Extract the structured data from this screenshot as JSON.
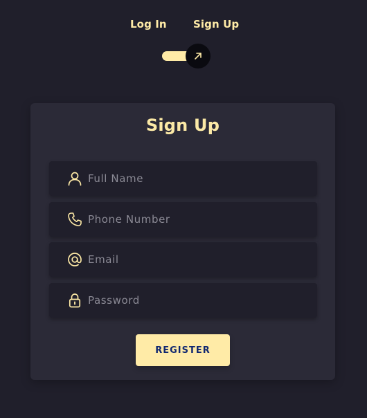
{
  "toggle": {
    "login_label": "Log In",
    "signup_label": "Sign Up",
    "state": "signup"
  },
  "card": {
    "title": "Sign Up",
    "fields": [
      {
        "icon": "user-icon",
        "value": "",
        "placeholder": "Full Name"
      },
      {
        "icon": "phone-icon",
        "value": "",
        "placeholder": "Phone Number"
      },
      {
        "icon": "at-icon",
        "value": "",
        "placeholder": "Email"
      },
      {
        "icon": "lock-icon",
        "value": "",
        "placeholder": "Password"
      }
    ],
    "submit_label": "REGISTER"
  },
  "colors": {
    "background": "#201f2b",
    "card": "#2b2a37",
    "accent": "#ffeba7",
    "button_text": "#102770",
    "placeholder": "#8b8a95"
  }
}
